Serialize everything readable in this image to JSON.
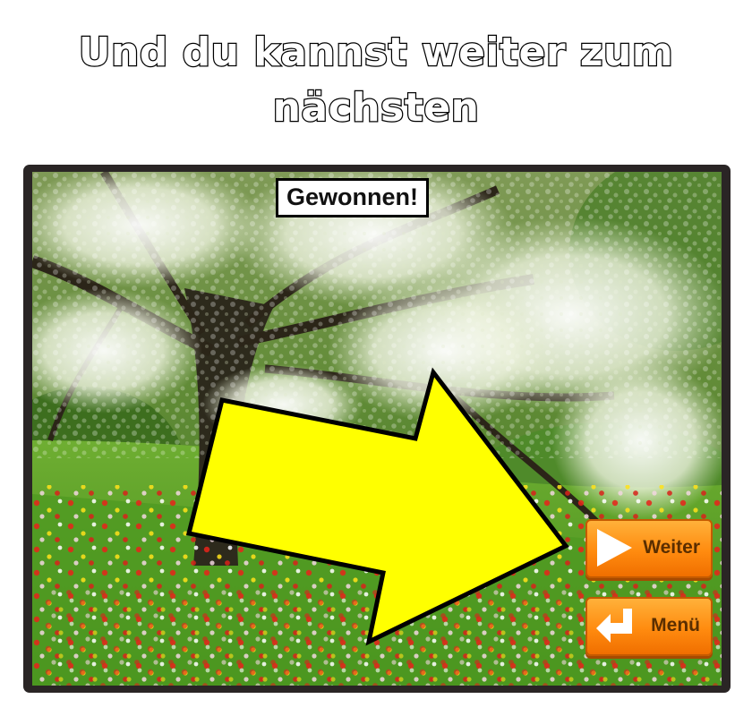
{
  "caption": {
    "line1": "Und du kannst weiter zum",
    "line2": "nächsten"
  },
  "game": {
    "status_label": "Gewonnen!",
    "buttons": {
      "next_label": "Weiter",
      "menu_label": "Menü"
    },
    "arrow_color": "#ffff00",
    "button_color": "#ff8b0f"
  }
}
